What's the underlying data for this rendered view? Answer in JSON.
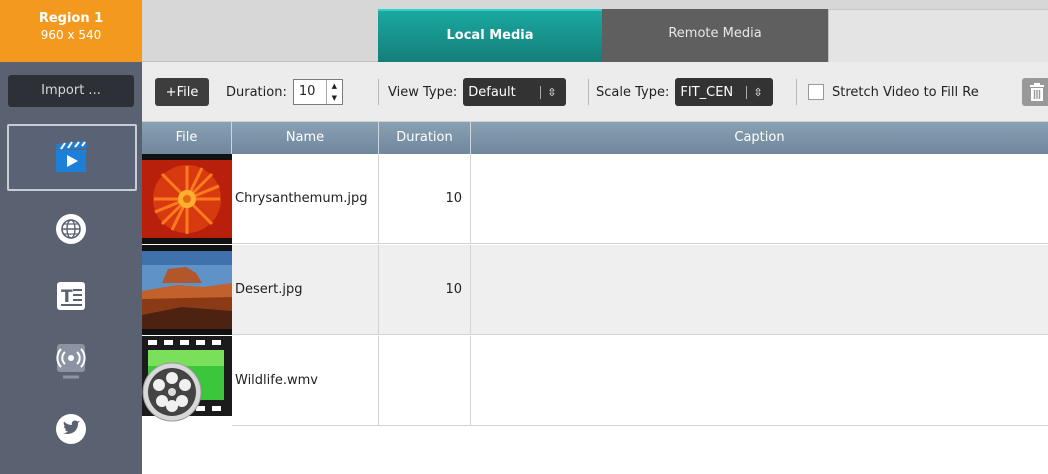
{
  "sidebar": {
    "region_title": "Region 1",
    "region_size": "960 x 540",
    "import_label": "Import ...",
    "icons": [
      "video-playlist-icon",
      "globe-icon",
      "text-icon",
      "broadcast-icon",
      "twitter-icon"
    ]
  },
  "tabs": [
    {
      "label": "Local Media",
      "active": true
    },
    {
      "label": "Remote Media",
      "active": false
    }
  ],
  "toolbar": {
    "add_file_label": "+File",
    "duration_label": "Duration:",
    "duration_value": "10",
    "view_type_label": "View Type:",
    "view_type_value": "Default",
    "scale_type_label": "Scale Type:",
    "scale_type_value": "FIT_CEN",
    "stretch_label": "Stretch Video to Fill Re"
  },
  "table": {
    "columns": [
      "File",
      "Name",
      "Duration",
      "Caption"
    ],
    "rows": [
      {
        "name": "Chrysanthemum.jpg",
        "duration": "10",
        "caption": ""
      },
      {
        "name": "Desert.jpg",
        "duration": "10",
        "caption": ""
      },
      {
        "name": "Wildlife.wmv",
        "duration": "",
        "caption": ""
      }
    ]
  },
  "colors": {
    "region_orange": "#f39a1e",
    "active_tab_teal": "#1aa8a0",
    "sidebar_gray": "#5a6272",
    "header_blue_gray": "#7a91a5"
  }
}
